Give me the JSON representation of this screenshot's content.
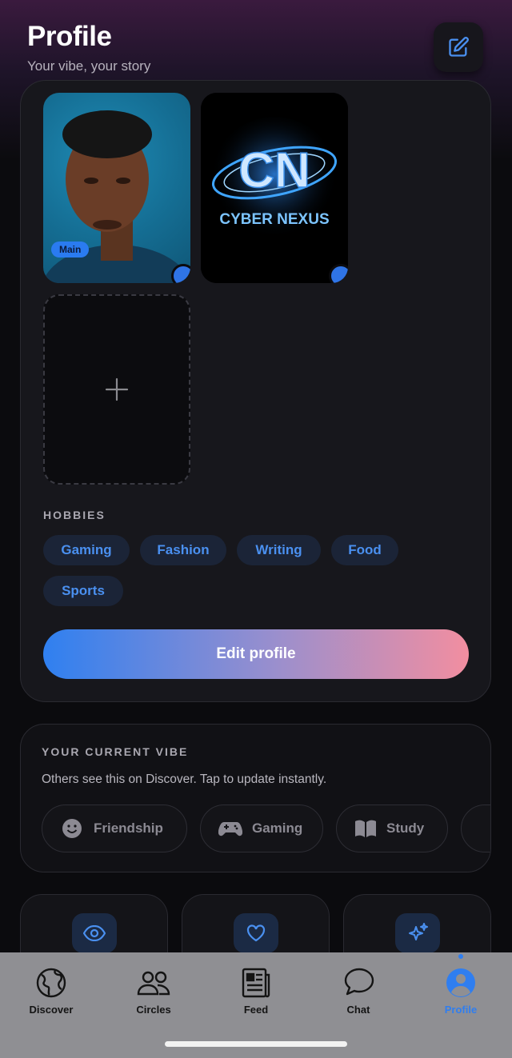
{
  "header": {
    "title": "Profile",
    "subtitle": "Your vibe, your story",
    "edit_icon": "edit-square-icon"
  },
  "photos": {
    "items": [
      {
        "badge": "Main",
        "kind": "portrait"
      },
      {
        "kind": "logo",
        "logo_text": "CYBER NEXUS",
        "logo_monogram": "CN"
      }
    ],
    "add_icon": "plus-icon"
  },
  "hobbies": {
    "label": "HOBBIES",
    "items": [
      "Gaming",
      "Fashion",
      "Writing",
      "Food",
      "Sports"
    ]
  },
  "edit_profile_label": "Edit profile",
  "vibe": {
    "label": "YOUR CURRENT VIBE",
    "description": "Others see this on Discover. Tap to update instantly.",
    "options": [
      {
        "label": "Friendship",
        "icon": "smile-icon"
      },
      {
        "label": "Gaming",
        "icon": "gamepad-icon"
      },
      {
        "label": "Study",
        "icon": "book-icon"
      }
    ]
  },
  "stats": [
    {
      "icon": "eye-icon"
    },
    {
      "icon": "heart-icon"
    },
    {
      "icon": "sparkles-icon"
    }
  ],
  "tabbar": {
    "items": [
      {
        "label": "Discover",
        "icon": "globe-icon"
      },
      {
        "label": "Circles",
        "icon": "people-icon"
      },
      {
        "label": "Feed",
        "icon": "newspaper-icon"
      },
      {
        "label": "Chat",
        "icon": "chat-bubble-icon"
      },
      {
        "label": "Profile",
        "icon": "person-circle-icon",
        "active": true
      }
    ]
  },
  "colors": {
    "accent": "#2f7ef0",
    "gradient_start": "#2f80f0",
    "gradient_end": "#f28ea0",
    "chip_bg": "#1b2437"
  }
}
